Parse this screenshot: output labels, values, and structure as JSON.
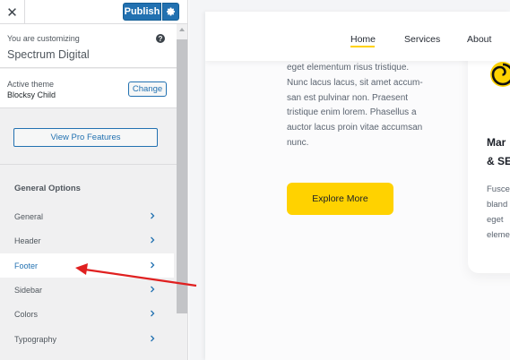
{
  "customizer": {
    "close_glyph": "✕",
    "publish_label": "Publish",
    "customizing_label": "You are customizing",
    "site_name": "Spectrum Digital",
    "help_glyph": "?",
    "active_theme_label": "Active theme",
    "active_theme_name": "Blocksy Child",
    "change_label": "Change",
    "pro_label": "View Pro Features",
    "section_title": "General Options",
    "menu": [
      {
        "label": "General",
        "active": false
      },
      {
        "label": "Header",
        "active": false
      },
      {
        "label": "Footer",
        "active": true
      },
      {
        "label": "Sidebar",
        "active": false
      },
      {
        "label": "Colors",
        "active": false
      },
      {
        "label": "Typography",
        "active": false
      }
    ],
    "accent_color": "#2271b1"
  },
  "preview": {
    "nav": [
      "Home",
      "Services",
      "About"
    ],
    "active_nav": "Home",
    "body_lines": [
      "eget elementum risus tristique.",
      "Nunc lacus lacus, sit amet accum-",
      "san est pulvinar non. Praesent",
      "tristique enim lorem. Phasellus a",
      "auctor lacus proin vitae accumsan",
      "nunc."
    ],
    "button_label": "Explore More",
    "card_title_lines": [
      "Mar",
      "& SE"
    ],
    "card_text_lines": [
      "Fusce",
      "bland",
      "eget",
      "eleme"
    ],
    "accent_color": "#ffd200"
  },
  "annotation": {
    "arrow_color": "#e02020",
    "target": "Footer"
  }
}
